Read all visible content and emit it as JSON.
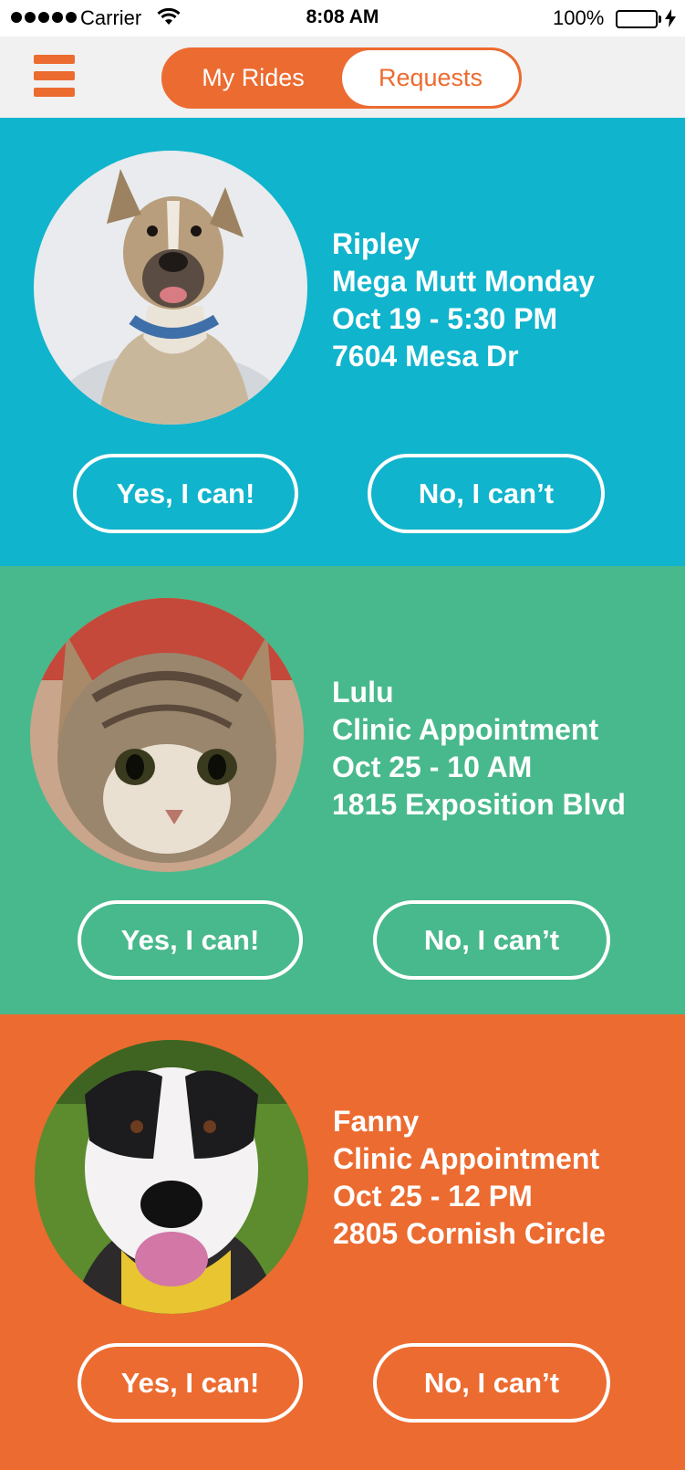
{
  "status_bar": {
    "carrier": "Carrier",
    "time": "8:08 AM",
    "battery_percent": "100%",
    "battery_level": 1.0,
    "battery_color": "#33dd11",
    "icons": [
      "signal-dots-icon",
      "wifi-icon",
      "battery-icon",
      "charging-bolt-icon"
    ]
  },
  "nav": {
    "menu_icon": "hamburger-menu-icon",
    "tabs": [
      {
        "label": "My Rides",
        "selected": false
      },
      {
        "label": "Requests",
        "selected": true
      }
    ],
    "accent_color": "#ec6b30"
  },
  "requests": [
    {
      "name": "Ripley",
      "event": "Mega Mutt Monday",
      "when": "Oct 19 - 5:30 PM",
      "address": "7604 Mesa Dr",
      "photo": "dog-photo",
      "color": "#10b4cc",
      "accept_label": "Yes, I can!",
      "decline_label": "No, I can’t"
    },
    {
      "name": "Lulu",
      "event": "Clinic Appointment",
      "when": "Oct 25 - 10 AM",
      "address": "1815 Exposition Blvd",
      "photo": "kitten-photo",
      "color": "#48b98c",
      "accept_label": "Yes, I can!",
      "decline_label": "No, I can’t"
    },
    {
      "name": "Fanny",
      "event": "Clinic Appointment",
      "when": "Oct 25 - 12 PM",
      "address": "2805 Cornish Circle",
      "photo": "dog-photo",
      "color": "#ec6b30",
      "accept_label": "Yes, I can!",
      "decline_label": "No, I can’t"
    }
  ]
}
